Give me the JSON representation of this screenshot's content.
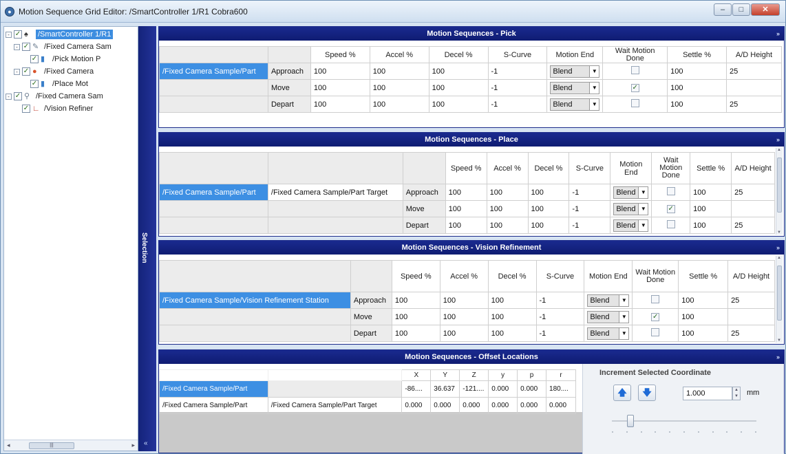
{
  "window": {
    "title": "Motion Sequence Grid Editor: /SmartController 1/R1 Cobra600"
  },
  "tree": {
    "items": [
      {
        "label": "/SmartController 1/R1",
        "exp": "-",
        "checked": "✓",
        "selected": true,
        "icon": "robot-icon",
        "color": "#333333"
      },
      {
        "label": "/Fixed Camera Sam",
        "exp": "-",
        "checked": "✓",
        "icon": "process-icon",
        "color": "#6b7c8f"
      },
      {
        "label": "/Pick Motion P",
        "exp": "",
        "checked": "✓",
        "icon": "pick-motion-icon",
        "color": "#3a7fc9"
      },
      {
        "label": "/Fixed Camera",
        "exp": "-",
        "checked": "✓",
        "icon": "camera-part-icon",
        "color": "#d9532b"
      },
      {
        "label": "/Place Mot",
        "exp": "",
        "checked": "✓",
        "icon": "place-motion-icon",
        "color": "#3a7fc9"
      },
      {
        "label": "/Fixed Camera Sam",
        "exp": "-",
        "checked": "✓",
        "icon": "vision-icon",
        "color": "#6b7c8f"
      },
      {
        "label": "/Vision Refiner",
        "exp": "",
        "checked": "✓",
        "icon": "refinement-icon",
        "color": "#c0392b"
      }
    ]
  },
  "sidebar": {
    "label": "Selection",
    "collapse": "«"
  },
  "pick": {
    "title": "Motion Sequences - Pick",
    "chev": "»",
    "headers": [
      "Speed %",
      "Accel %",
      "Decel %",
      "S-Curve",
      "Motion End",
      "Wait Motion Done",
      "Settle %",
      "A/D Height"
    ],
    "part": "/Fixed Camera Sample/Part",
    "rows": [
      {
        "label": "Approach",
        "speed": "100",
        "accel": "100",
        "decel": "100",
        "scurve": "-1",
        "end": "Blend",
        "wait": "",
        "settle": "100",
        "ad": "25"
      },
      {
        "label": "Move",
        "speed": "100",
        "accel": "100",
        "decel": "100",
        "scurve": "-1",
        "end": "Blend",
        "wait": "✓",
        "settle": "100",
        "ad": ""
      },
      {
        "label": "Depart",
        "speed": "100",
        "accel": "100",
        "decel": "100",
        "scurve": "-1",
        "end": "Blend",
        "wait": "",
        "settle": "100",
        "ad": "25"
      }
    ]
  },
  "place": {
    "title": "Motion Sequences - Place",
    "chev": "»",
    "headers": [
      "Speed %",
      "Accel %",
      "Decel %",
      "S-Curve",
      "Motion End",
      "Wait Motion Done",
      "Settle %",
      "A/D Height"
    ],
    "part": "/Fixed Camera Sample/Part",
    "target": "/Fixed Camera Sample/Part Target",
    "rows": [
      {
        "label": "Approach",
        "speed": "100",
        "accel": "100",
        "decel": "100",
        "scurve": "-1",
        "end": "Blend",
        "wait": "",
        "settle": "100",
        "ad": "25"
      },
      {
        "label": "Move",
        "speed": "100",
        "accel": "100",
        "decel": "100",
        "scurve": "-1",
        "end": "Blend",
        "wait": "✓",
        "settle": "100",
        "ad": ""
      },
      {
        "label": "Depart",
        "speed": "100",
        "accel": "100",
        "decel": "100",
        "scurve": "-1",
        "end": "Blend",
        "wait": "",
        "settle": "100",
        "ad": "25"
      }
    ]
  },
  "vision": {
    "title": "Motion Sequences - Vision Refinement",
    "chev": "»",
    "headers": [
      "Speed %",
      "Accel %",
      "Decel %",
      "S-Curve",
      "Motion End",
      "Wait Motion Done",
      "Settle %",
      "A/D Height"
    ],
    "station": "/Fixed Camera Sample/Vision Refinement Station",
    "rows": [
      {
        "label": "Approach",
        "speed": "100",
        "accel": "100",
        "decel": "100",
        "scurve": "-1",
        "end": "Blend",
        "wait": "",
        "settle": "100",
        "ad": "25"
      },
      {
        "label": "Move",
        "speed": "100",
        "accel": "100",
        "decel": "100",
        "scurve": "-1",
        "end": "Blend",
        "wait": "✓",
        "settle": "100",
        "ad": ""
      },
      {
        "label": "Depart",
        "speed": "100",
        "accel": "100",
        "decel": "100",
        "scurve": "-1",
        "end": "Blend",
        "wait": "",
        "settle": "100",
        "ad": "25"
      }
    ]
  },
  "offset": {
    "title": "Motion Sequences - Offset Locations",
    "chev": "»",
    "headers": [
      "X",
      "Y",
      "Z",
      "y",
      "p",
      "r"
    ],
    "rows": [
      {
        "c1": "/Fixed Camera Sample/Part",
        "c2": "",
        "vals": [
          "-86....",
          "36.637",
          "-121....",
          "0.000",
          "0.000",
          "180...."
        ]
      },
      {
        "c1": "/Fixed Camera Sample/Part",
        "c2": "/Fixed Camera Sample/Part Target",
        "vals": [
          "0.000",
          "0.000",
          "0.000",
          "0.000",
          "0.000",
          "0.000"
        ]
      }
    ],
    "increment": {
      "title": "Increment Selected Coordinate",
      "up": "🡅",
      "down": "🡇",
      "value": "1.000",
      "unit": "mm"
    }
  }
}
